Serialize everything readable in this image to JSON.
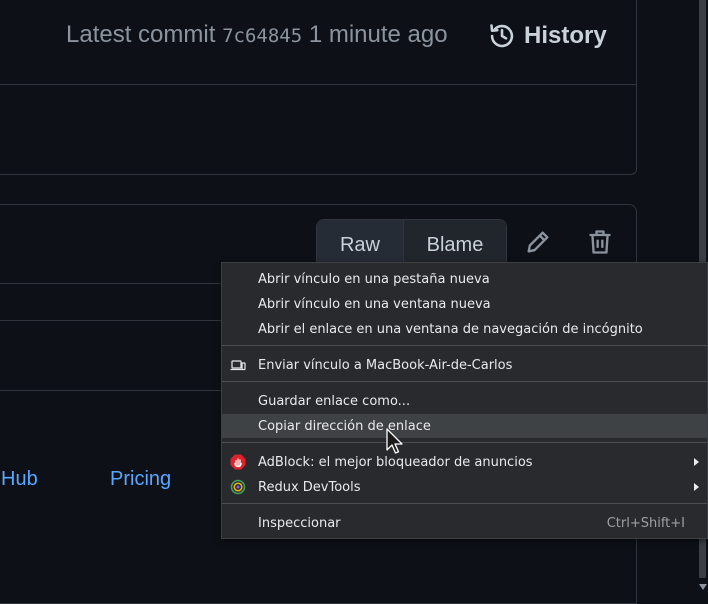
{
  "commit": {
    "prefix": "Latest commit",
    "sha": "7c64845",
    "time": "1 minute ago",
    "history_label": "History"
  },
  "file_actions": {
    "raw_label": "Raw",
    "blame_label": "Blame"
  },
  "footer": {
    "hub_label": "Hub",
    "pricing_label": "Pricing"
  },
  "context_menu": {
    "items": [
      {
        "label": "Abrir vínculo en una pestaña nueva"
      },
      {
        "label": "Abrir vínculo en una ventana nueva"
      },
      {
        "label": "Abrir el enlace en una ventana de navegación de incógnito"
      },
      {
        "label": "Enviar vínculo a MacBook-Air-de-Carlos",
        "icon": "device-icon"
      },
      {
        "label": "Guardar enlace como..."
      },
      {
        "label": "Copiar dirección de enlace",
        "highlighted": true
      },
      {
        "label": "AdBlock: el mejor bloqueador de anuncios",
        "icon": "adblock-icon",
        "submenu": true
      },
      {
        "label": "Redux DevTools",
        "icon": "redux-icon",
        "submenu": true
      },
      {
        "label": "Inspeccionar",
        "shortcut": "Ctrl+Shift+I"
      }
    ]
  },
  "colors": {
    "background": "#0d1117",
    "link": "#58a6ff",
    "menu_bg": "#282a2d",
    "menu_highlight": "#3f4245"
  }
}
